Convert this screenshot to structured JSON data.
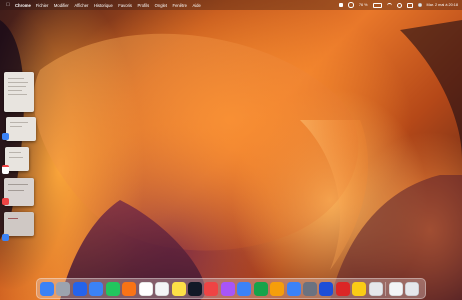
{
  "menubar": {
    "app_name": "Chrome",
    "items": [
      "Fichier",
      "Modifier",
      "Afficher",
      "Historique",
      "Favoris",
      "Profils",
      "Onglet",
      "Fenêtre",
      "Aide"
    ],
    "battery": "76 %",
    "datetime": "Mar. 2 mai à 20:18"
  },
  "dock": {
    "apps": [
      {
        "name": "finder-icon",
        "color": "#3b82f6"
      },
      {
        "name": "launchpad-icon",
        "color": "#9ca3af"
      },
      {
        "name": "safari-icon",
        "color": "#2563eb"
      },
      {
        "name": "mail-icon",
        "color": "#3b82f6"
      },
      {
        "name": "facetime-icon",
        "color": "#22c55e"
      },
      {
        "name": "photos-icon",
        "color": "#f97316"
      },
      {
        "name": "calendar-icon",
        "color": "#ffffff"
      },
      {
        "name": "reminders-icon",
        "color": "#f3f4f6"
      },
      {
        "name": "notes-icon",
        "color": "#fde047"
      },
      {
        "name": "tv-remote-icon",
        "color": "#111827"
      },
      {
        "name": "music-icon",
        "color": "#ef4444"
      },
      {
        "name": "podcasts-icon",
        "color": "#a855f7"
      },
      {
        "name": "keynote-icon",
        "color": "#3b82f6"
      },
      {
        "name": "numbers-icon",
        "color": "#16a34a"
      },
      {
        "name": "pages-icon",
        "color": "#f59e0b"
      },
      {
        "name": "app-store-icon",
        "color": "#3b82f6"
      },
      {
        "name": "system-settings-icon",
        "color": "#6b7280"
      },
      {
        "name": "word-icon",
        "color": "#1d4ed8"
      },
      {
        "name": "acrobat-icon",
        "color": "#dc2626"
      },
      {
        "name": "chrome-icon",
        "color": "#facc15"
      },
      {
        "name": "preview-icon",
        "color": "#e5e7eb"
      }
    ],
    "after_sep": [
      {
        "name": "document-icon",
        "color": "#f3f4f6"
      },
      {
        "name": "trash-icon",
        "color": "#e5e7eb"
      }
    ]
  },
  "stage": {
    "thumbnails": [
      {
        "name": "stage-window-1"
      },
      {
        "name": "stage-window-2"
      },
      {
        "name": "stage-window-3"
      },
      {
        "name": "stage-window-4"
      },
      {
        "name": "stage-window-5"
      }
    ]
  }
}
